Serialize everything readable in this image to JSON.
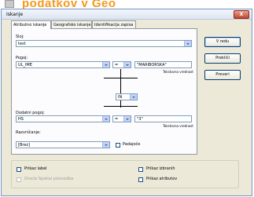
{
  "banner": {
    "text": "podatkov v Geo"
  },
  "window": {
    "title": "Iskanje",
    "close_label": "X"
  },
  "tabs": [
    {
      "label": "Atributno iskanje"
    },
    {
      "label": "Geografsko iskanje"
    },
    {
      "label": "Identifikacija zapisa"
    }
  ],
  "form": {
    "sloj_label": "Sloj:",
    "sloj_value": "test",
    "pogoj_label": "Pogoj:",
    "pogoj_field": "UL_IME",
    "pogoj_operator": "=",
    "pogoj_value": "\"MARIBORSKA\"",
    "pogoj_hint": "Tekstovna vrednost",
    "connector": "IN",
    "dodatni_label": "Dodatni pogoj:",
    "dodatni_field": "HS",
    "dodatni_operator": "=",
    "dodatni_value": "\"3\"",
    "dodatni_hint": "Tekstovna vrednost",
    "razvrscanje_label": "Razvrščanje:",
    "razvrscanje_value": "[Brez]",
    "padajoce_label": "Padajoče"
  },
  "buttons": {
    "ok": "V redu",
    "cancel": "Prekliči",
    "check": "Preveri"
  },
  "options": {
    "prikaz_label": "Prikaz label",
    "oracle_spatial": "Oracle Spatial poizvedba",
    "prikaz_izbranih": "Prikaz izbranih",
    "prikaz_atributov": "Prikaz atributov"
  }
}
